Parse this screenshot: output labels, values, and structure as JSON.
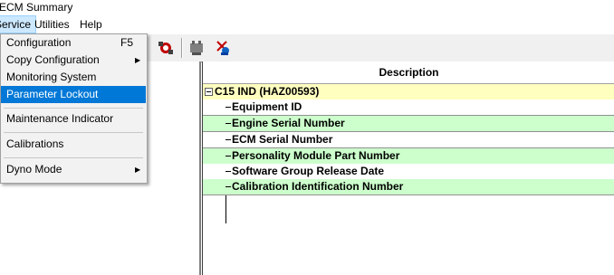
{
  "window": {
    "title": "ECM Summary"
  },
  "menu": {
    "items": [
      {
        "label": "Service"
      },
      {
        "label": "Utilities"
      },
      {
        "label": "Help"
      }
    ]
  },
  "service_menu": {
    "items": [
      {
        "label": "Configuration",
        "shortcut": "F5"
      },
      {
        "label": "Copy Configuration",
        "submenu_arrow": "▶"
      },
      {
        "label": "Monitoring System"
      },
      {
        "label": "Parameter Lockout"
      },
      {
        "label": "Maintenance Indicator"
      },
      {
        "label": "Calibrations"
      },
      {
        "label": "Dyno Mode",
        "submenu_arrow": "▶"
      }
    ]
  },
  "table": {
    "header": "Description",
    "root": {
      "toggle": "⊟",
      "label": "C15 IND (HAZ00593)"
    },
    "rows": [
      {
        "label": "Equipment ID"
      },
      {
        "label": "Engine Serial Number"
      },
      {
        "label": "ECM Serial Number"
      },
      {
        "label": "Personality Module Part Number"
      },
      {
        "label": "Software Group Release Date"
      },
      {
        "label": "Calibration Identification Number"
      }
    ]
  },
  "colors": {
    "root_row": "#ffffc0",
    "alt_row": "#ccffcc",
    "menu_highlight": "#0078d7"
  },
  "toolbar": {
    "icons": [
      "ecm-settings-icon",
      "transmit-icon",
      "satellite-icon"
    ]
  }
}
